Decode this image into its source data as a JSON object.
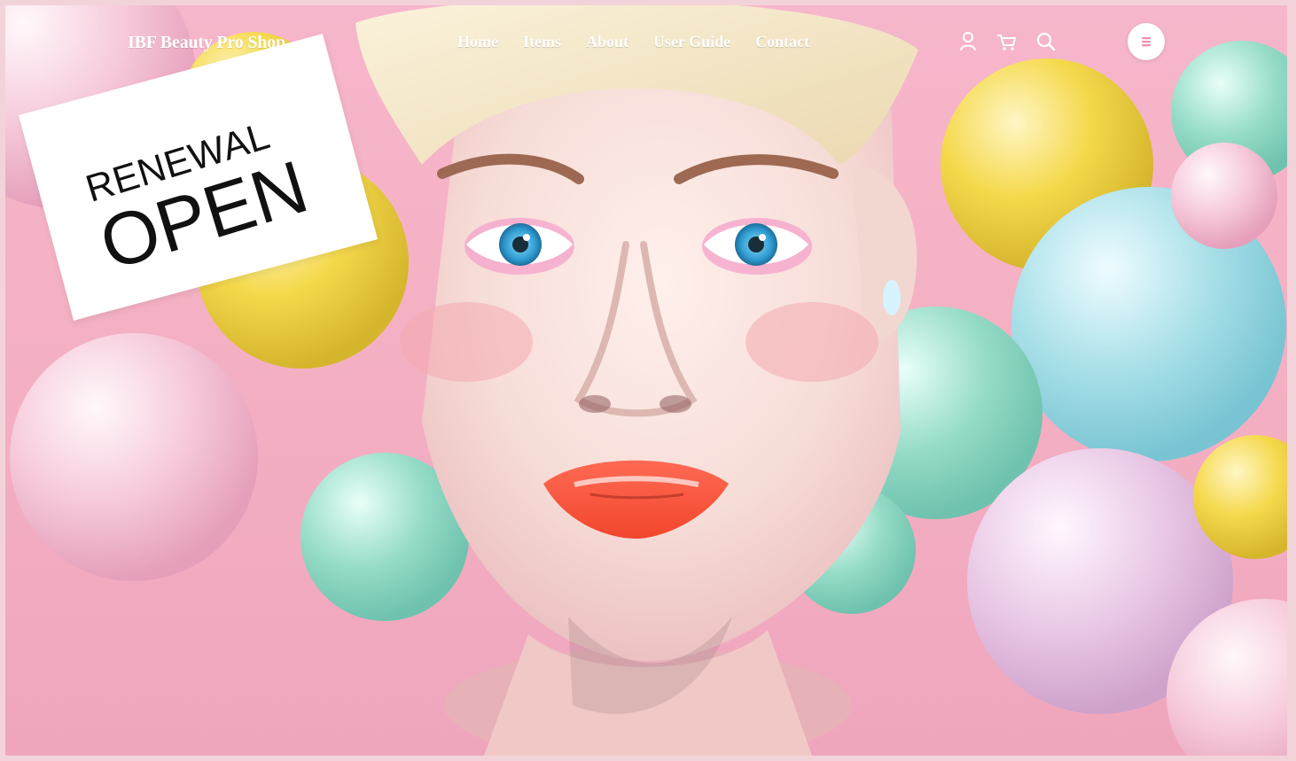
{
  "site": {
    "logo": "IBF Beauty Pro Shop"
  },
  "navigation": {
    "items": [
      "Home",
      "Items",
      "About",
      "User Guide",
      "Contact"
    ]
  },
  "header_icons": {
    "account": "user-icon",
    "cart": "cart-icon",
    "search": "search-icon",
    "menu": "menu-icon"
  },
  "hero": {
    "sign_line1": "RENEWAL",
    "sign_line2": "OPEN"
  },
  "colors": {
    "page_background": "#f3d3da",
    "sign_background": "#ffffff",
    "text_primary": "#111111",
    "nav_text": "#ffffff"
  }
}
